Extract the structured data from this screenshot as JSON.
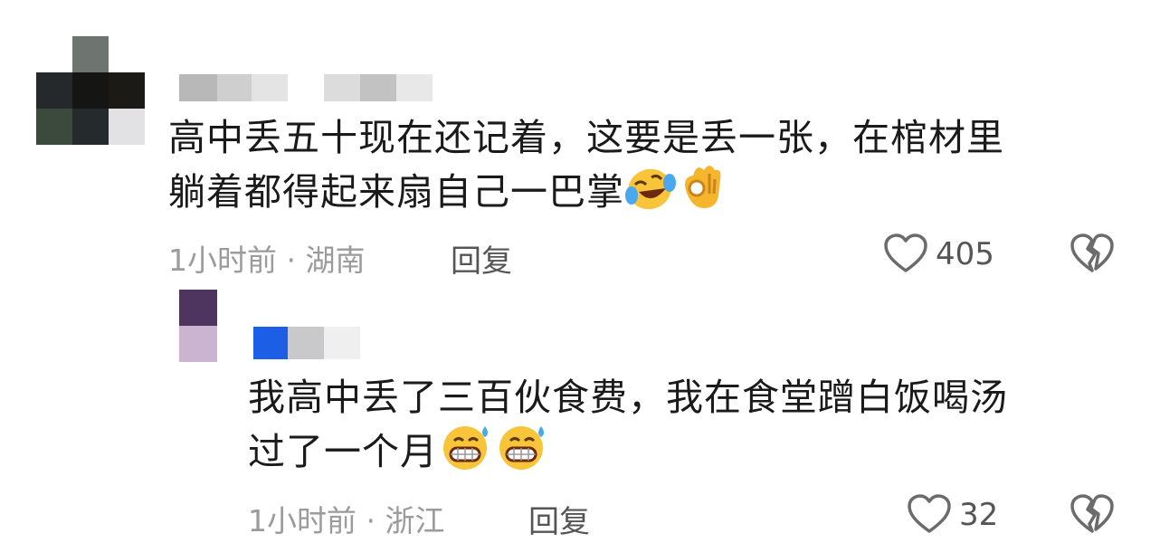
{
  "comments": [
    {
      "text_line1": "高中丢五十现在还记着，这要是丢一张，在棺材里",
      "text_line2": "躺着都得起来扇自己一巴掌",
      "emojis": [
        "face-with-tears-of-joy-icon",
        "ok-hand-icon"
      ],
      "time": "1小时前",
      "location": "湖南",
      "reply_label": "回复",
      "like_count": "405",
      "avatar_colors": [
        "#ffffff",
        "#6e7570",
        "#ffffff",
        "#25292b",
        "#151514",
        "#1c1a17",
        "#3b4a3c",
        "#252a2c",
        "#e2e2e4"
      ],
      "username_colors": [
        "#b8b8b8",
        "#cfcfcf",
        "#e4e4e4",
        "#ffffff",
        "#dcdcdc",
        "#c2c2c2",
        "#e8e8e8"
      ]
    },
    {
      "text_line1": "我高中丢了三百伙食费，我在食堂蹭白饭喝汤",
      "text_line2": "过了一个月",
      "emojis": [
        "grinning-face-with-sweat-icon",
        "grinning-face-with-sweat-icon"
      ],
      "time": "1小时前",
      "location": "浙江",
      "reply_label": "回复",
      "like_count": "32",
      "avatar_colors": [
        "#4d3560",
        "#cbb4d2"
      ],
      "username_colors": [
        "#1d5ee6",
        "#c9c9cb",
        "#efefef"
      ]
    }
  ],
  "separator": "·"
}
